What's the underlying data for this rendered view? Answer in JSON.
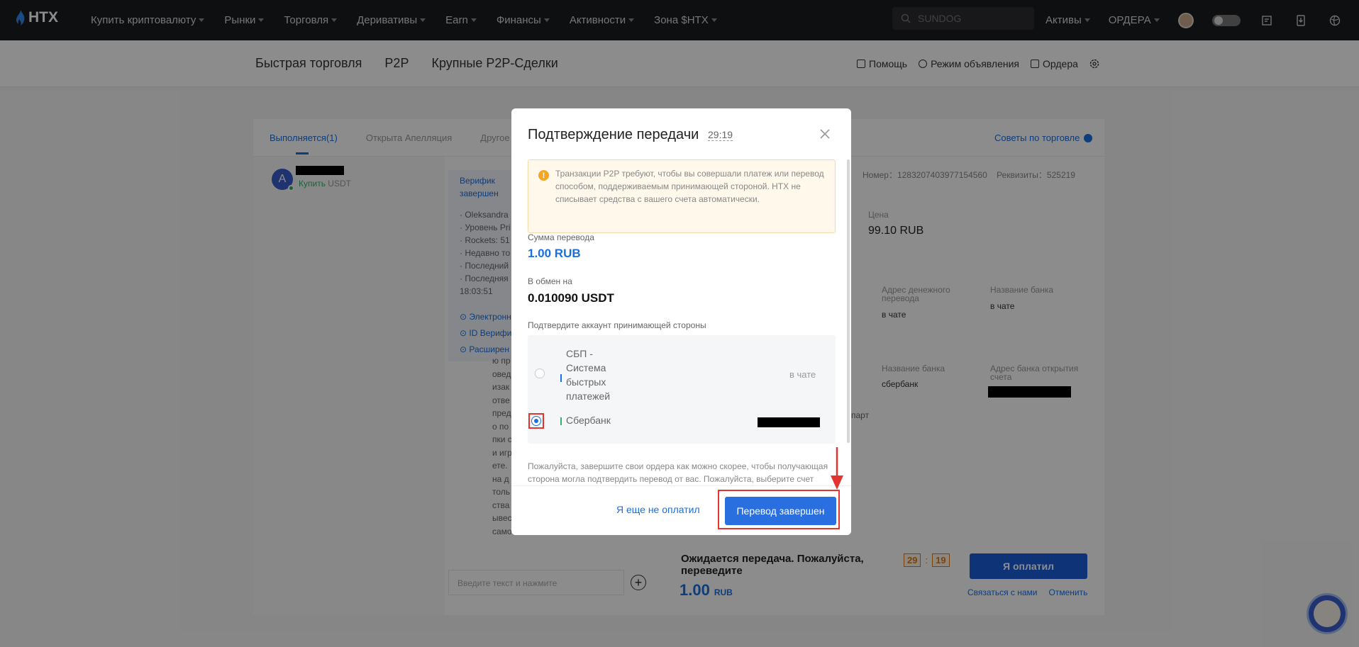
{
  "nav": {
    "logo": "HTX",
    "items": [
      "Купить криптовалюту",
      "Рынки",
      "Торговля",
      "Деривативы",
      "Earn",
      "Финансы",
      "Активности",
      "Зона $HTX"
    ],
    "search_placeholder": "SUNDOG",
    "assets": "Активы",
    "orders": "ОРДЕРА"
  },
  "subheader": {
    "tabs": [
      "Быстрая торговля",
      "P2P",
      "Крупные P2P-Сделки"
    ],
    "help": "Помощь",
    "ad_mode": "Режим объявления",
    "orders": "Ордера"
  },
  "background": {
    "tabs": [
      "Выполняется(1)",
      "Открыта Апелляция",
      "Другое"
    ],
    "tips": "Советы по торговле",
    "avatar_letter": "A",
    "buy_label": "Купить",
    "buy_coin": "USDT",
    "verify_title": [
      "Верифик",
      "завершен"
    ],
    "verify_lines": [
      "· Oleksandra",
      "· Уровень Pri",
      "· Rockets: 51",
      "· Недавно то",
      "· Последний",
      "· Последняя",
      "18:03:51"
    ],
    "verify_links": [
      "⊙ Электронн",
      "⊙ ID Верифи",
      "⊙ Расширен"
    ],
    "chat_lines": [
      "ю пр",
      "овед",
      "изак",
      "отве",
      "пред",
      "о по",
      "пки с",
      "и игр",
      "ете.",
      "на д",
      "толь",
      "ства",
      "ывес",
      "само"
    ],
    "order_number_label": "Номер：",
    "order_number": "1283207403977154560",
    "requisites_label": "Реквизиты：",
    "requisites": "525219",
    "price_label": "Цена",
    "price_value": "99.10 RUB",
    "addr_label": "Адрес денежного перевода",
    "addr_value": "в чате",
    "bank_label": "Название банка",
    "bank_value": "в чате",
    "bank_label2": "Название банка",
    "bank_value2": "сбербанк",
    "bank_addr_label": "Адрес банка открытия счета",
    "part_fragment": "парт",
    "chat_placeholder": "Введите текст и нажмите",
    "pay_title": "Ожидается передача. Пожалуйста, переведите",
    "pay_amount": "1.00",
    "pay_currency": "RUB",
    "timer_min": "29",
    "timer_sep": ":",
    "timer_sec": "19",
    "paid_button": "Я оплатил",
    "contact_link": "Связаться с нами",
    "cancel_link": "Отменить"
  },
  "modal": {
    "title": "Подтверждение передачи",
    "timer": "29:19",
    "warning": "Транзакции P2P требуют, чтобы вы совершали платеж или перевод способом, поддерживаемым принимающей стороной. HTX не списывает средства с вашего счета автоматически.",
    "amount_label": "Сумма перевода",
    "amount_value": "1.00 RUB",
    "exchange_label": "В обмен на",
    "exchange_value": "0.010090 USDT",
    "confirm_label": "Подтвердите аккаунт принимающей стороны",
    "accounts": [
      {
        "name": "СБП - Система быстрых платежей",
        "value": "в чате",
        "selected": false,
        "bar_color": "#1a6fe0"
      },
      {
        "name": "Сбербанк",
        "value": "",
        "selected": true,
        "bar_color": "#2fb365"
      }
    ],
    "note": "Пожалуйста, завершите свои ордера как можно скорее, чтобы получающая сторона могла подтвердить перевод от вас. Пожалуйста, выберите счет",
    "not_paid": "Я еще не оплатил",
    "done": "Перевод завершен"
  },
  "colors": {
    "accent": "#1a6fe0",
    "highlight": "#e3342f",
    "warning": "#f5a623"
  }
}
